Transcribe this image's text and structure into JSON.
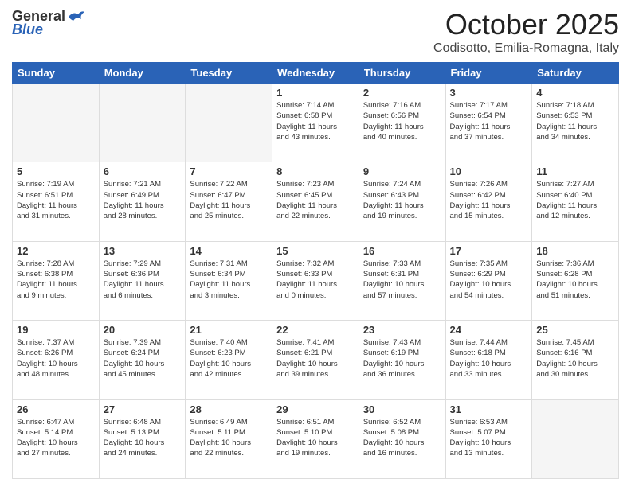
{
  "logo": {
    "general": "General",
    "blue": "Blue"
  },
  "header": {
    "month": "October 2025",
    "location": "Codisotto, Emilia-Romagna, Italy"
  },
  "days_of_week": [
    "Sunday",
    "Monday",
    "Tuesday",
    "Wednesday",
    "Thursday",
    "Friday",
    "Saturday"
  ],
  "weeks": [
    [
      {
        "day": "",
        "info": ""
      },
      {
        "day": "",
        "info": ""
      },
      {
        "day": "",
        "info": ""
      },
      {
        "day": "1",
        "info": "Sunrise: 7:14 AM\nSunset: 6:58 PM\nDaylight: 11 hours\nand 43 minutes."
      },
      {
        "day": "2",
        "info": "Sunrise: 7:16 AM\nSunset: 6:56 PM\nDaylight: 11 hours\nand 40 minutes."
      },
      {
        "day": "3",
        "info": "Sunrise: 7:17 AM\nSunset: 6:54 PM\nDaylight: 11 hours\nand 37 minutes."
      },
      {
        "day": "4",
        "info": "Sunrise: 7:18 AM\nSunset: 6:53 PM\nDaylight: 11 hours\nand 34 minutes."
      }
    ],
    [
      {
        "day": "5",
        "info": "Sunrise: 7:19 AM\nSunset: 6:51 PM\nDaylight: 11 hours\nand 31 minutes."
      },
      {
        "day": "6",
        "info": "Sunrise: 7:21 AM\nSunset: 6:49 PM\nDaylight: 11 hours\nand 28 minutes."
      },
      {
        "day": "7",
        "info": "Sunrise: 7:22 AM\nSunset: 6:47 PM\nDaylight: 11 hours\nand 25 minutes."
      },
      {
        "day": "8",
        "info": "Sunrise: 7:23 AM\nSunset: 6:45 PM\nDaylight: 11 hours\nand 22 minutes."
      },
      {
        "day": "9",
        "info": "Sunrise: 7:24 AM\nSunset: 6:43 PM\nDaylight: 11 hours\nand 19 minutes."
      },
      {
        "day": "10",
        "info": "Sunrise: 7:26 AM\nSunset: 6:42 PM\nDaylight: 11 hours\nand 15 minutes."
      },
      {
        "day": "11",
        "info": "Sunrise: 7:27 AM\nSunset: 6:40 PM\nDaylight: 11 hours\nand 12 minutes."
      }
    ],
    [
      {
        "day": "12",
        "info": "Sunrise: 7:28 AM\nSunset: 6:38 PM\nDaylight: 11 hours\nand 9 minutes."
      },
      {
        "day": "13",
        "info": "Sunrise: 7:29 AM\nSunset: 6:36 PM\nDaylight: 11 hours\nand 6 minutes."
      },
      {
        "day": "14",
        "info": "Sunrise: 7:31 AM\nSunset: 6:34 PM\nDaylight: 11 hours\nand 3 minutes."
      },
      {
        "day": "15",
        "info": "Sunrise: 7:32 AM\nSunset: 6:33 PM\nDaylight: 11 hours\nand 0 minutes."
      },
      {
        "day": "16",
        "info": "Sunrise: 7:33 AM\nSunset: 6:31 PM\nDaylight: 10 hours\nand 57 minutes."
      },
      {
        "day": "17",
        "info": "Sunrise: 7:35 AM\nSunset: 6:29 PM\nDaylight: 10 hours\nand 54 minutes."
      },
      {
        "day": "18",
        "info": "Sunrise: 7:36 AM\nSunset: 6:28 PM\nDaylight: 10 hours\nand 51 minutes."
      }
    ],
    [
      {
        "day": "19",
        "info": "Sunrise: 7:37 AM\nSunset: 6:26 PM\nDaylight: 10 hours\nand 48 minutes."
      },
      {
        "day": "20",
        "info": "Sunrise: 7:39 AM\nSunset: 6:24 PM\nDaylight: 10 hours\nand 45 minutes."
      },
      {
        "day": "21",
        "info": "Sunrise: 7:40 AM\nSunset: 6:23 PM\nDaylight: 10 hours\nand 42 minutes."
      },
      {
        "day": "22",
        "info": "Sunrise: 7:41 AM\nSunset: 6:21 PM\nDaylight: 10 hours\nand 39 minutes."
      },
      {
        "day": "23",
        "info": "Sunrise: 7:43 AM\nSunset: 6:19 PM\nDaylight: 10 hours\nand 36 minutes."
      },
      {
        "day": "24",
        "info": "Sunrise: 7:44 AM\nSunset: 6:18 PM\nDaylight: 10 hours\nand 33 minutes."
      },
      {
        "day": "25",
        "info": "Sunrise: 7:45 AM\nSunset: 6:16 PM\nDaylight: 10 hours\nand 30 minutes."
      }
    ],
    [
      {
        "day": "26",
        "info": "Sunrise: 6:47 AM\nSunset: 5:14 PM\nDaylight: 10 hours\nand 27 minutes."
      },
      {
        "day": "27",
        "info": "Sunrise: 6:48 AM\nSunset: 5:13 PM\nDaylight: 10 hours\nand 24 minutes."
      },
      {
        "day": "28",
        "info": "Sunrise: 6:49 AM\nSunset: 5:11 PM\nDaylight: 10 hours\nand 22 minutes."
      },
      {
        "day": "29",
        "info": "Sunrise: 6:51 AM\nSunset: 5:10 PM\nDaylight: 10 hours\nand 19 minutes."
      },
      {
        "day": "30",
        "info": "Sunrise: 6:52 AM\nSunset: 5:08 PM\nDaylight: 10 hours\nand 16 minutes."
      },
      {
        "day": "31",
        "info": "Sunrise: 6:53 AM\nSunset: 5:07 PM\nDaylight: 10 hours\nand 13 minutes."
      },
      {
        "day": "",
        "info": ""
      }
    ]
  ]
}
